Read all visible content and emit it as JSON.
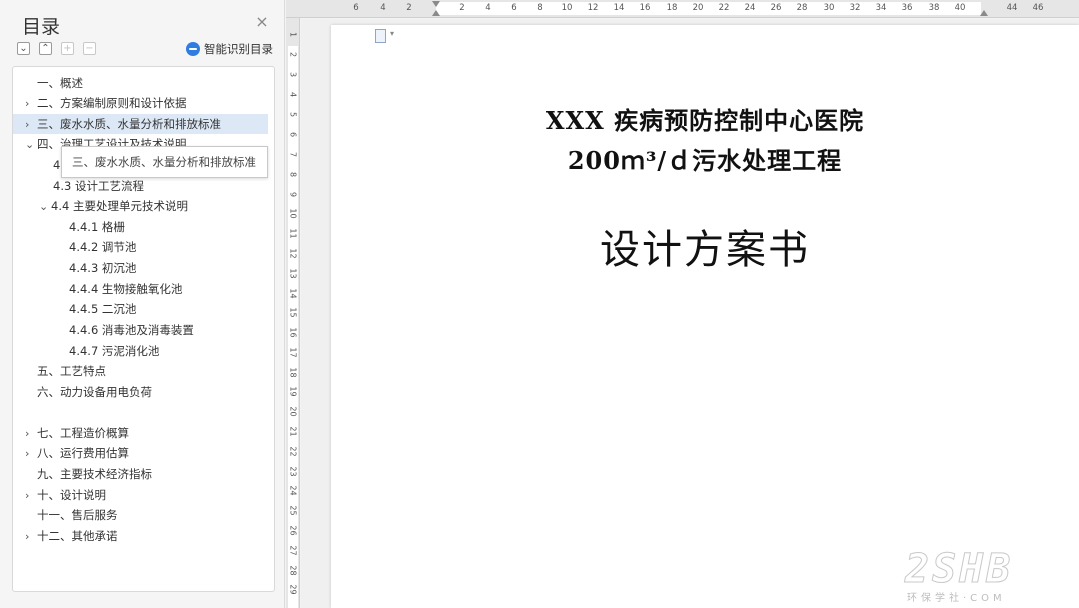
{
  "toc": {
    "title": "目录",
    "close_icon": "×",
    "smart_toc_label": "智能识别目录",
    "tooltip": "三、废水水质、水量分析和排放标准",
    "items": [
      {
        "label": "一、概述",
        "chevron": ""
      },
      {
        "label": "二、方案编制原则和设计依据",
        "chevron": "›"
      },
      {
        "label": "三、废水水质、水量分析和排放标准",
        "chevron": "›"
      },
      {
        "label": "四、治理工艺设计及技术说明",
        "chevron": "⌄"
      },
      {
        "label": "4",
        "chevron": ""
      },
      {
        "label": "4.3 设计工艺流程",
        "chevron": ""
      },
      {
        "label": "4.4 主要处理单元技术说明",
        "chevron": "⌄"
      },
      {
        "label": "4.4.1 格栅",
        "chevron": ""
      },
      {
        "label": "4.4.2 调节池",
        "chevron": ""
      },
      {
        "label": "4.4.3 初沉池",
        "chevron": ""
      },
      {
        "label": "4.4.4 生物接触氧化池",
        "chevron": ""
      },
      {
        "label": "4.4.5 二沉池",
        "chevron": ""
      },
      {
        "label": "4.4.6 消毒池及消毒装置",
        "chevron": ""
      },
      {
        "label": "4.4.7 污泥消化池",
        "chevron": ""
      },
      {
        "label": "五、工艺特点",
        "chevron": ""
      },
      {
        "label": "六、动力设备用电负荷",
        "chevron": ""
      },
      {
        "label": "七、工程造价概算",
        "chevron": "›"
      },
      {
        "label": "八、运行费用估算",
        "chevron": "›"
      },
      {
        "label": "九、主要技术经济指标",
        "chevron": ""
      },
      {
        "label": "十、设计说明",
        "chevron": "›"
      },
      {
        "label": "十一、售后服务",
        "chevron": ""
      },
      {
        "label": "十二、其他承诺",
        "chevron": "›"
      }
    ]
  },
  "ruler": {
    "horizontal": [
      "6",
      "4",
      "2",
      "2",
      "4",
      "6",
      "8",
      "10",
      "12",
      "14",
      "16",
      "18",
      "20",
      "22",
      "24",
      "26",
      "28",
      "30",
      "32",
      "34",
      "36",
      "38",
      "40",
      "44",
      "46"
    ],
    "vertical": [
      "1",
      "2",
      "3",
      "4",
      "5",
      "6",
      "7",
      "8",
      "9",
      "10",
      "11",
      "12",
      "13",
      "14",
      "15",
      "16",
      "17",
      "18",
      "19",
      "20",
      "21",
      "22",
      "23",
      "24",
      "25",
      "26",
      "27",
      "28",
      "29"
    ]
  },
  "document": {
    "line1": "XXX 疾病预防控制中心医院",
    "line2": "200ｍ³/ｄ污水处理工程",
    "line3": "设计方案书"
  },
  "watermark": {
    "main": "2SHB",
    "sub": "环保学社·COM"
  }
}
